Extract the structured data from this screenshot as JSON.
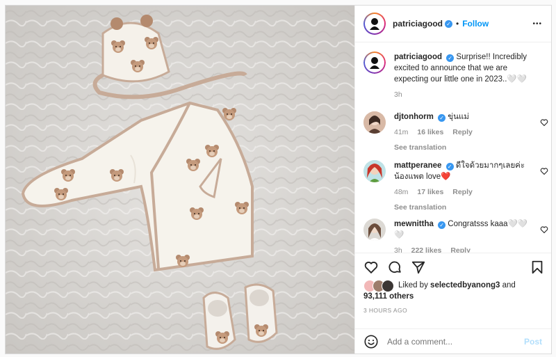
{
  "post": {
    "username": "patriciagood",
    "follow_separator": "•",
    "follow_label": "Follow",
    "more_label": "•••"
  },
  "caption": {
    "username": "patriciagood",
    "text": "Surprise!! Incredibly excited to announce that we are expecting our little one in 2023..🤍🤍",
    "time": "3h"
  },
  "comments": [
    {
      "username": "djtonhorm",
      "text": "ขุ่นแม่",
      "time": "41m",
      "likes": "16 likes",
      "reply": "Reply",
      "see_translation": "See translation"
    },
    {
      "username": "mattperanee",
      "text": "ดีใจด้วยมากๆเลยค่ะน้องแพต love❤️",
      "time": "48m",
      "likes": "17 likes",
      "reply": "Reply",
      "see_translation": "See translation"
    },
    {
      "username": "mewnittha",
      "text": "Congratsss kaaa🤍🤍🤍",
      "time": "3h",
      "likes": "222 likes",
      "reply": "Reply"
    }
  ],
  "likes": {
    "prefix": "Liked by",
    "user": "selectedbyanong3",
    "and": "and",
    "count": "93,111 others"
  },
  "timestamp": "3 HOURS AGO",
  "add_comment": {
    "placeholder": "Add a comment...",
    "post_label": "Post"
  },
  "colors": {
    "accent": "#0095f6",
    "verified": "#3897f0",
    "heart_red": "#ed4956"
  }
}
